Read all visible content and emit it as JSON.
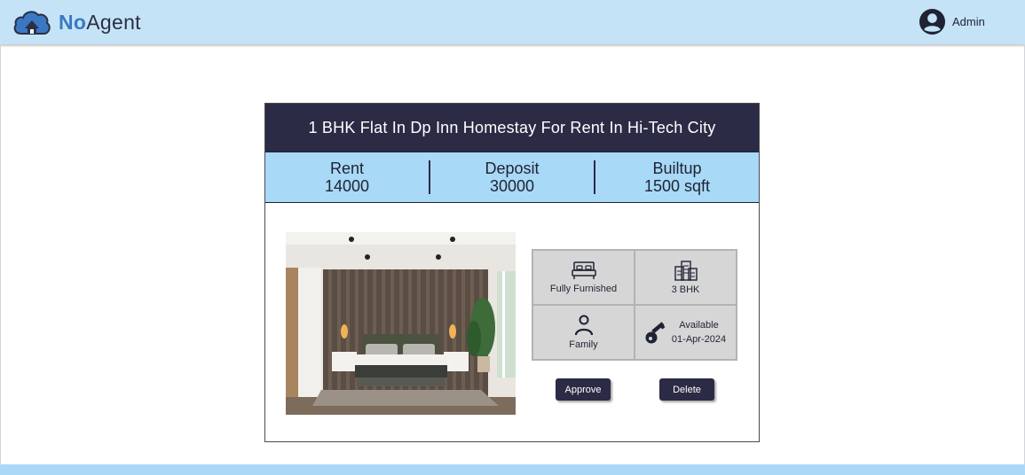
{
  "header": {
    "brand_bold": "No",
    "brand_rest": "Agent",
    "user_label": "Admin"
  },
  "listing": {
    "title": "1 BHK Flat In Dp Inn Homestay For Rent In Hi-Tech City",
    "stats": [
      {
        "label": "Rent",
        "value": "14000"
      },
      {
        "label": "Deposit",
        "value": "30000"
      },
      {
        "label": "Builtup",
        "value": "1500 sqft"
      }
    ],
    "features": {
      "furnishing": "Fully Furnished",
      "bhk": "3 BHK",
      "tenant": "Family",
      "availability_label": "Available",
      "availability_date": "01-Apr-2024"
    },
    "actions": {
      "approve_label": "Approve",
      "delete_label": "Delete"
    }
  },
  "icons": {
    "logo": "cloud-house-icon",
    "user": "user-circle-icon",
    "furnishing": "bed-icon",
    "bhk": "building-icon",
    "tenant": "person-icon",
    "availability": "key-icon"
  },
  "colors": {
    "header_bg": "#c4e3f7",
    "brand_accent": "#3b78c4",
    "title_bar": "#2c2b45",
    "stats_bar": "#a8d9f7",
    "feature_bg": "#d6d6d6",
    "button_bg": "#2c2b45",
    "footer": "#aad9f7"
  }
}
